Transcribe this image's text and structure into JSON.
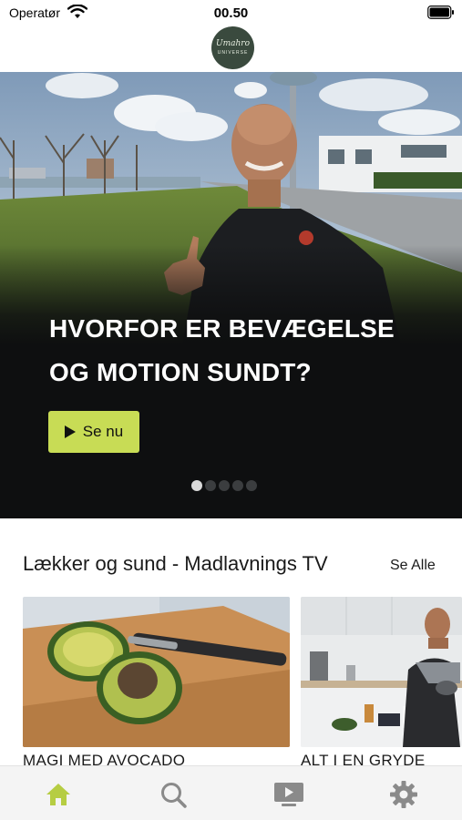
{
  "status_bar": {
    "carrier": "Operatør",
    "time": "00.50"
  },
  "logo": {
    "script": "Umahro",
    "sub": "UNIVERSE"
  },
  "hero": {
    "title": "HVORFOR ER BEVÆGELSE OG MOTION SUNDT?",
    "button_label": "Se nu",
    "page_count": 5,
    "active_page": 0
  },
  "section": {
    "title": "Lækker og sund - Madlavnings TV",
    "see_all_label": "Se Alle",
    "cards": [
      {
        "label": "MAGI MED AVOCADO"
      },
      {
        "label": "ALT I EN GRYDE"
      }
    ]
  },
  "tab_bar": {
    "items": [
      {
        "icon": "home-icon",
        "active": true
      },
      {
        "icon": "search-icon",
        "active": false
      },
      {
        "icon": "video-icon",
        "active": false
      },
      {
        "icon": "gear-icon",
        "active": false
      }
    ]
  },
  "colors": {
    "accent": "#c8dc55",
    "hero_background": "#0e0f10",
    "tab_active": "#b6cd43",
    "tab_inactive": "#8a8a8a"
  }
}
